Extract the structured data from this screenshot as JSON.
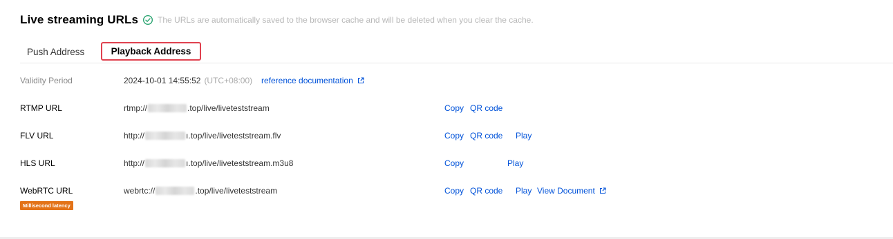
{
  "header": {
    "title": "Live streaming URLs",
    "note": "The URLs are automatically saved to the browser cache and will be deleted when you clear the cache."
  },
  "tabs": [
    {
      "label": "Push Address"
    },
    {
      "label": "Playback Address",
      "active": true
    }
  ],
  "validity": {
    "label": "Validity Period",
    "value": "2024-10-01 14:55:52",
    "timezone": "(UTC+08:00)",
    "link": "reference documentation"
  },
  "rows": {
    "rtmp": {
      "label": "RTMP URL",
      "prefix": "rtmp://",
      "suffix": ".top/live/liveteststream",
      "copy": "Copy",
      "qr": "QR code"
    },
    "flv": {
      "label": "FLV URL",
      "prefix": "http://",
      "suffix": "ı.top/live/liveteststream.flv",
      "copy": "Copy",
      "qr": "QR code",
      "play": "Play"
    },
    "hls": {
      "label": "HLS URL",
      "prefix": "http://",
      "suffix": "ı.top/live/liveteststream.m3u8",
      "copy": "Copy",
      "play": "Play"
    },
    "webrtc": {
      "label": "WebRTC URL",
      "badge": "Millisecond latency",
      "prefix": "webrtc://",
      "suffix": ".top/live/liveteststream",
      "copy": "Copy",
      "qr": "QR code",
      "play": "Play",
      "doc": "View Document"
    }
  },
  "colors": {
    "link": "#0052d9",
    "success": "#2ba471",
    "badge": "#e37318",
    "tab_highlight": "#e0414f"
  },
  "icons": {
    "verified": "check-circle-icon",
    "external": "external-link-icon"
  }
}
